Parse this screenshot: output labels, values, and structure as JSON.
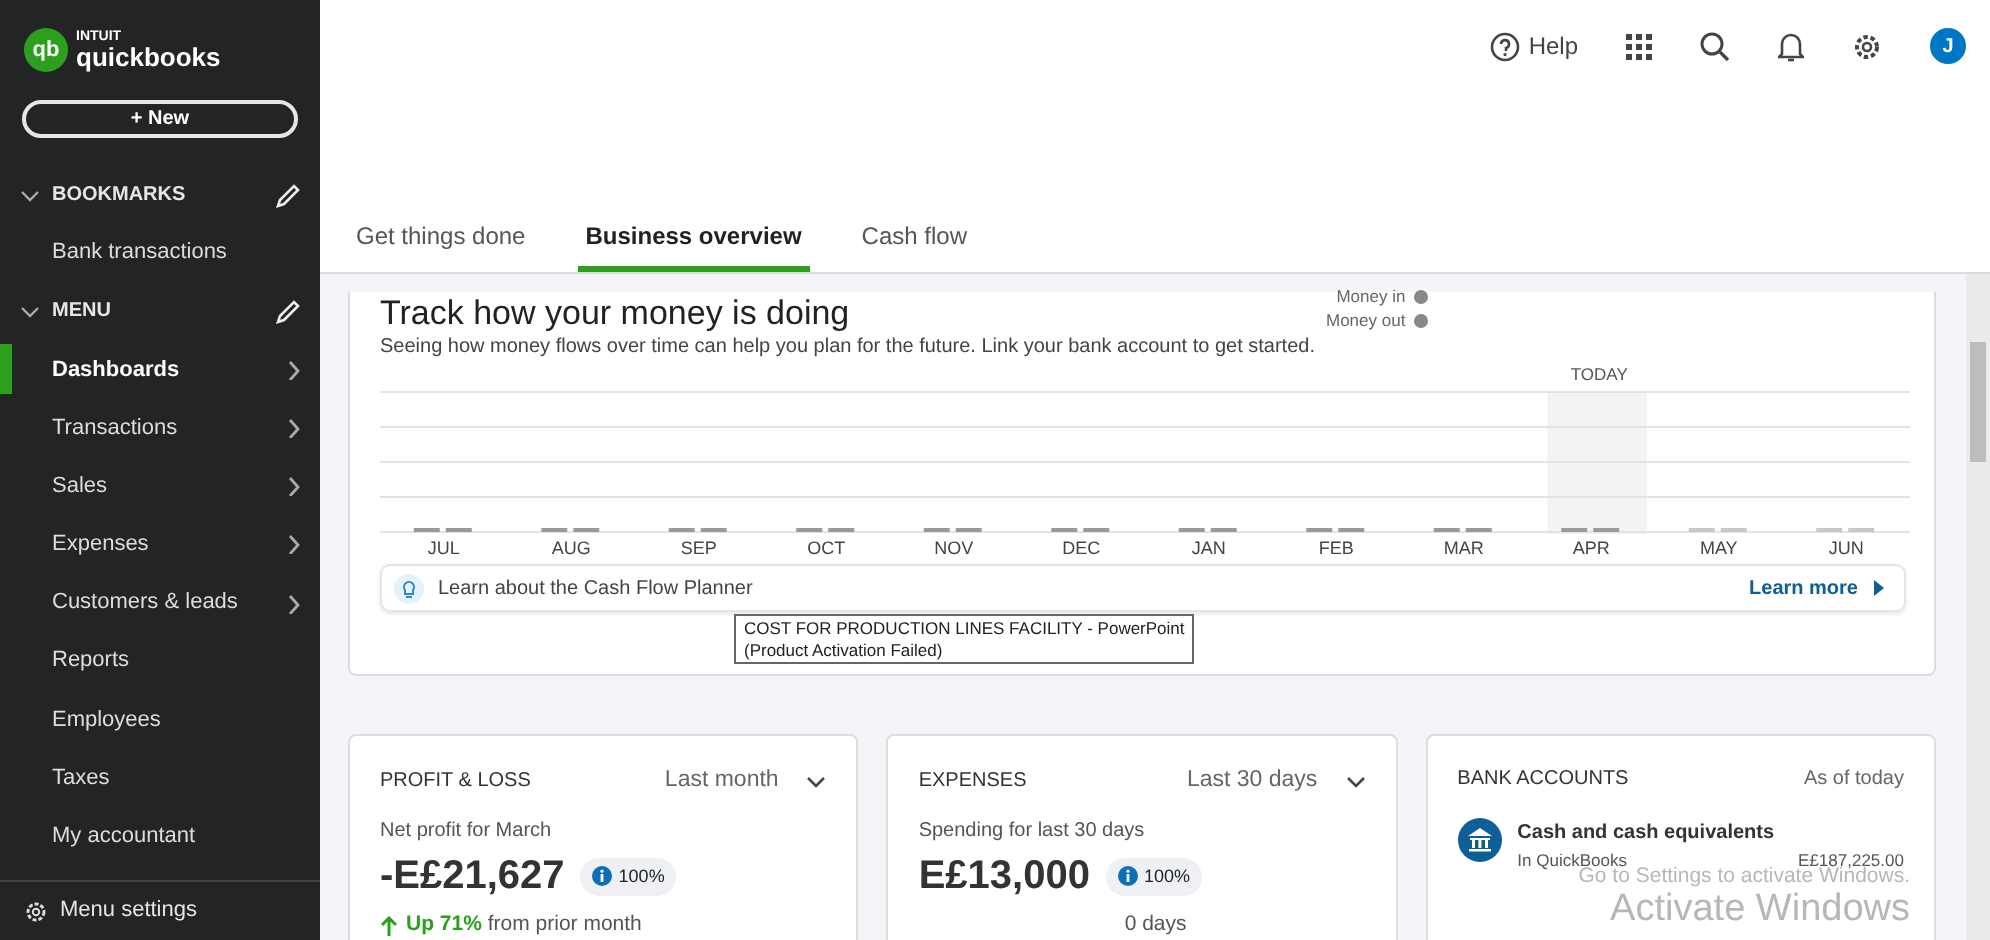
{
  "logo": {
    "brand_top": "INTUIT",
    "brand": "quickbooks",
    "mark": "qb"
  },
  "new_button": "+ New",
  "sidebar": {
    "sections": [
      {
        "title": "BOOKMARKS",
        "expanded": true,
        "items": [
          {
            "label": "Bank transactions",
            "selected": false,
            "has_submenu": false
          }
        ]
      },
      {
        "title": "MENU",
        "expanded": true,
        "items": [
          {
            "label": "Dashboards",
            "selected": true,
            "has_submenu": true
          },
          {
            "label": "Transactions",
            "selected": false,
            "has_submenu": true
          },
          {
            "label": "Sales",
            "selected": false,
            "has_submenu": true
          },
          {
            "label": "Expenses",
            "selected": false,
            "has_submenu": true
          },
          {
            "label": "Customers & leads",
            "selected": false,
            "has_submenu": true
          },
          {
            "label": "Reports",
            "selected": false,
            "has_submenu": false
          },
          {
            "label": "Employees",
            "selected": false,
            "has_submenu": false
          },
          {
            "label": "Taxes",
            "selected": false,
            "has_submenu": false
          },
          {
            "label": "My accountant",
            "selected": false,
            "has_submenu": false
          }
        ]
      }
    ],
    "footer": "Menu settings"
  },
  "header": {
    "help": "Help",
    "avatar": "J"
  },
  "tabs": [
    {
      "label": "Get things done",
      "selected": false
    },
    {
      "label": "Business overview",
      "selected": true
    },
    {
      "label": "Cash flow",
      "selected": false
    }
  ],
  "cash_card": {
    "legend": [
      "Money in",
      "Money out"
    ],
    "title": "Track how your money is doing",
    "subtitle": "Seeing how money flows over time can help you plan for the future. Link your bank account to get started.",
    "today": "TODAY",
    "months": [
      {
        "label": "JUL",
        "today": false
      },
      {
        "label": "AUG",
        "today": false
      },
      {
        "label": "SEP",
        "today": false
      },
      {
        "label": "OCT",
        "today": false
      },
      {
        "label": "NOV",
        "today": false
      },
      {
        "label": "DEC",
        "today": false
      },
      {
        "label": "JAN",
        "today": false
      },
      {
        "label": "FEB",
        "today": false
      },
      {
        "label": "MAR",
        "today": false
      },
      {
        "label": "APR",
        "today": true
      },
      {
        "label": "MAY",
        "today": false
      },
      {
        "label": "JUN",
        "today": false
      }
    ],
    "tip": "Learn about the Cash Flow Planner",
    "tip_link": "Learn more"
  },
  "widgets": [
    {
      "title": "PROFIT & LOSS",
      "period": "Last month",
      "caption": "Net profit for March",
      "amount": "-E£21,627",
      "badge": "100%",
      "trend_bold": "Up 71%",
      "trend": "from prior month"
    },
    {
      "title": "EXPENSES",
      "period": "Last 30 days",
      "caption": "Spending for last 30 days",
      "amount": "E£13,000",
      "badge": "100%",
      "trend_tail": "0 days"
    }
  ],
  "bank": {
    "title": "BANK ACCOUNTS",
    "as_of": "As of today",
    "account": "Cash and cash equivalents",
    "source": "In QuickBooks",
    "balance": "E£187,225.00"
  },
  "tooltip": {
    "line1": "COST FOR PRODUCTION LINES FACILITY  - PowerPoint",
    "line2": "(Product Activation Failed)"
  },
  "activation": {
    "hint": "Go to Settings to activate Windows.",
    "large": "Activate Windows"
  }
}
